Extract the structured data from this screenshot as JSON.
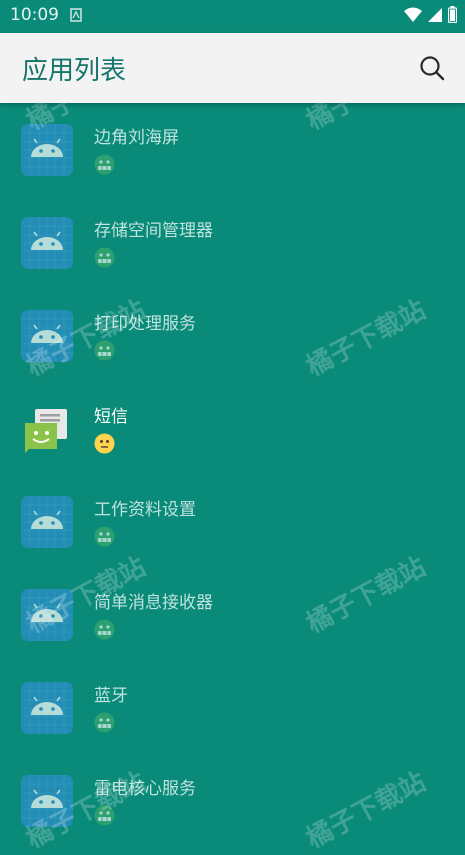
{
  "status_bar": {
    "time": "10:09"
  },
  "app_bar": {
    "title": "应用列表"
  },
  "apps": [
    {
      "name": "边角刘海屏",
      "icon": "android-icon",
      "badge": "android-face-icon",
      "enabled": false
    },
    {
      "name": "存储空间管理器",
      "icon": "android-icon",
      "badge": "android-face-icon",
      "enabled": false
    },
    {
      "name": "打印处理服务",
      "icon": "android-icon",
      "badge": "android-face-icon",
      "enabled": false
    },
    {
      "name": "短信",
      "icon": "messaging-icon",
      "badge": "neutral-face-emoji-icon",
      "enabled": true
    },
    {
      "name": "工作资料设置",
      "icon": "android-icon",
      "badge": "android-face-icon",
      "enabled": false
    },
    {
      "name": "简单消息接收器",
      "icon": "android-icon",
      "badge": "android-face-icon",
      "enabled": false
    },
    {
      "name": "蓝牙",
      "icon": "android-icon",
      "badge": "android-face-icon",
      "enabled": false
    },
    {
      "name": "雷电核心服务",
      "icon": "android-icon",
      "badge": "android-face-icon",
      "enabled": false
    }
  ],
  "watermark": "橘子下载站",
  "colors": {
    "background": "#0a8a78",
    "app_bar": "#f3f3f3",
    "title": "#15756a",
    "android_tile": "#2f8fd0"
  }
}
